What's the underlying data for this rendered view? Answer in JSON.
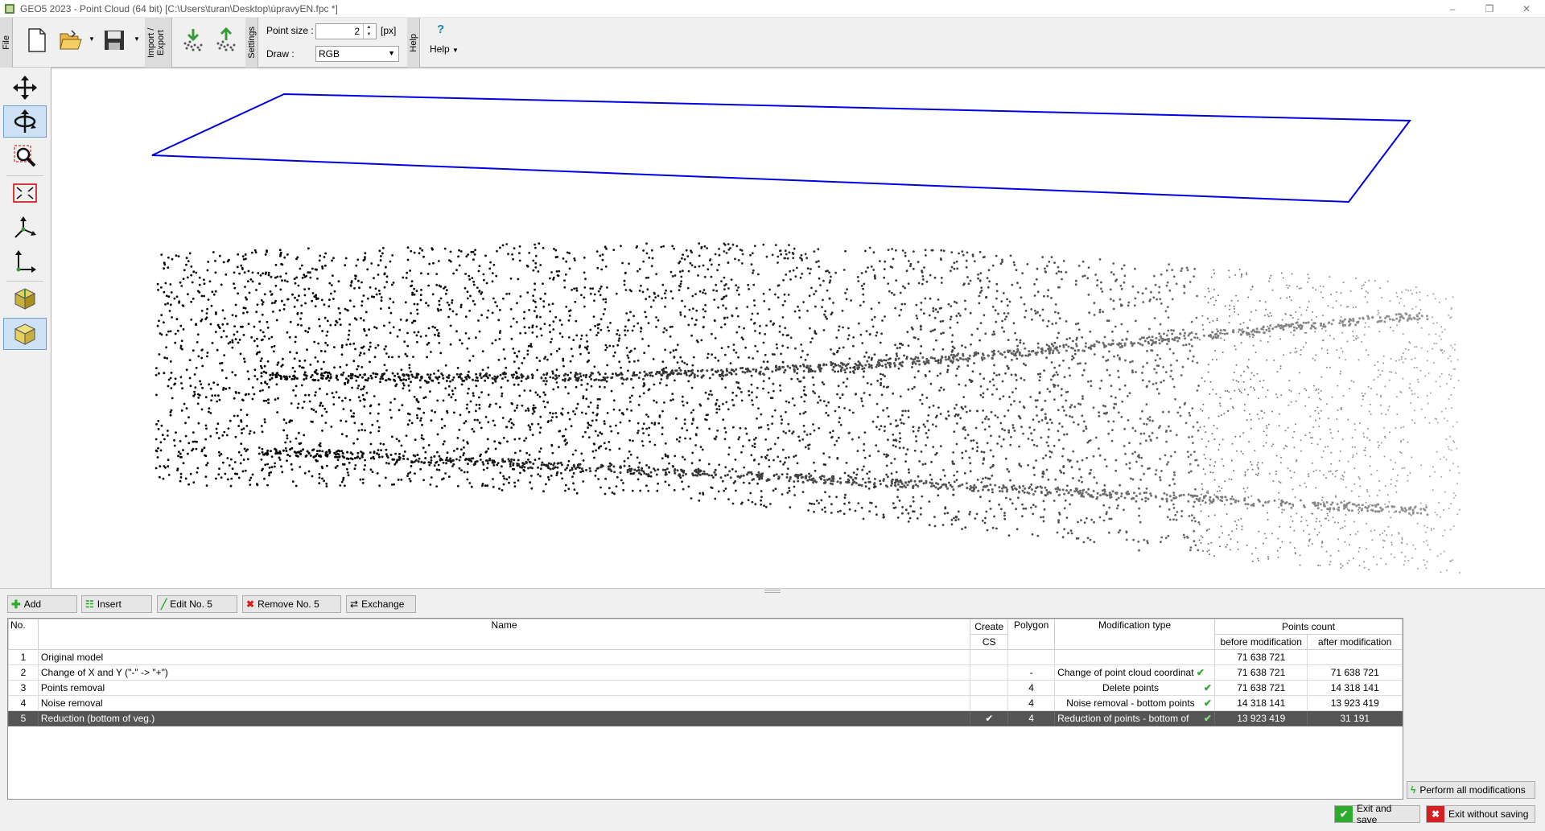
{
  "window": {
    "title": "GEO5 2023 - Point Cloud (64 bit) [C:\\Users\\turan\\Desktop\\úpravyEN.fpc *]",
    "minimize": "–",
    "restore": "❐",
    "close": "✕"
  },
  "toolbar": {
    "file_tab": "File",
    "import_export_tab": "Import / Export",
    "settings_tab": "Settings",
    "help_tab": "Help",
    "point_size_label": "Point size :",
    "point_size_value": "2",
    "point_size_unit": "[px]",
    "draw_label": "Draw :",
    "draw_value": "RGB",
    "help_menu": "Help",
    "help_icon": "?"
  },
  "left_tools": [
    "move-icon",
    "rotate-icon",
    "zoom-icon",
    "zoom-extents-icon",
    "axes-icon",
    "coordinate-system-icon",
    "view-cube-icon",
    "3d-view-icon"
  ],
  "actions": {
    "add": "Add",
    "insert": "Insert",
    "edit": "Edit No. 5",
    "remove": "Remove No. 5",
    "exchange": "Exchange"
  },
  "table": {
    "headers": {
      "no": "No.",
      "name": "Name",
      "create_cs_1": "Create",
      "create_cs_2": "CS",
      "polygon": "Polygon",
      "mod_type": "Modification type",
      "points_count": "Points count",
      "before": "before modification",
      "after": "after modification"
    },
    "rows": [
      {
        "no": "1",
        "name": "Original model",
        "cs": "",
        "polygon": "",
        "type": "",
        "check": "",
        "before": "71 638 721",
        "after": ""
      },
      {
        "no": "2",
        "name": "Change of X and Y (\"-\" -> \"+\")",
        "cs": "",
        "polygon": "-",
        "type": "Change of point cloud coordinat",
        "check": "✔",
        "before": "71 638 721",
        "after": "71 638 721"
      },
      {
        "no": "3",
        "name": "Points removal",
        "cs": "",
        "polygon": "4",
        "type": "Delete points",
        "check": "✔",
        "before": "71 638 721",
        "after": "14 318 141"
      },
      {
        "no": "4",
        "name": "Noise removal",
        "cs": "",
        "polygon": "4",
        "type": "Noise removal - bottom points",
        "check": "✔",
        "before": "14 318 141",
        "after": "13 923 419"
      },
      {
        "no": "5",
        "name": "Reduction (bottom of veg.)",
        "cs": "✔",
        "polygon": "4",
        "type": "Reduction of points - bottom of",
        "check": "✔",
        "before": "13 923 419",
        "after": "31 191"
      }
    ]
  },
  "buttons": {
    "perform_all": "Perform all modifications",
    "exit_save": "Exit and save",
    "exit_nosave": "Exit without saving"
  },
  "colors": {
    "selected_row": "#555555",
    "ok_green": "#2eaa2e",
    "cancel_red": "#d42020",
    "plane_blue": "#0000dd"
  }
}
